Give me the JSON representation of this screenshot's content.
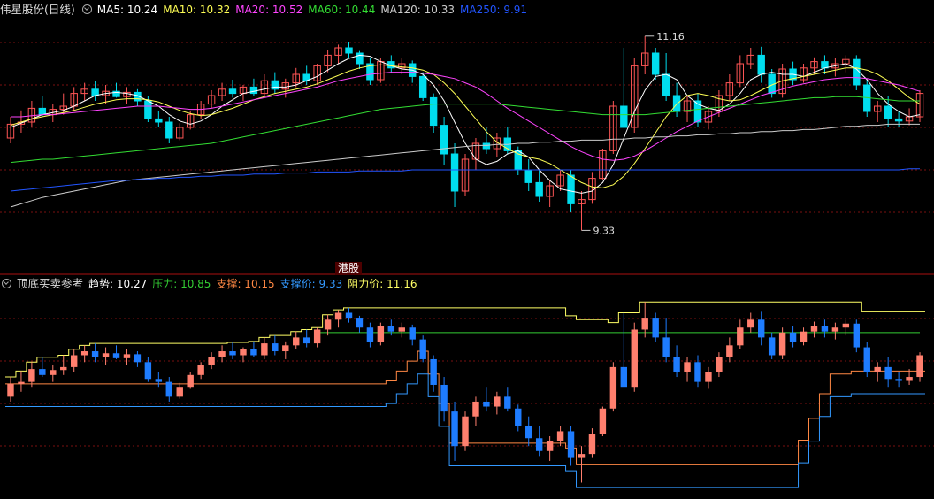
{
  "main_header": {
    "title": "伟星股份(日线)",
    "ma": [
      {
        "label": "MA5: 10.24",
        "color": "#ffffff"
      },
      {
        "label": "MA10: 10.32",
        "color": "#ffff55"
      },
      {
        "label": "MA20: 10.52",
        "color": "#ff44ff"
      },
      {
        "label": "MA60: 10.44",
        "color": "#33dd33"
      },
      {
        "label": "MA120: 10.33",
        "color": "#cccccc"
      },
      {
        "label": "MA250: 9.91",
        "color": "#2255ff"
      }
    ]
  },
  "hk_button": "港股",
  "sub_header": {
    "title": "顶底买卖参考",
    "items": [
      {
        "label": "趋势: 10.27",
        "color": "#ffffff"
      },
      {
        "label": "压力: 10.85",
        "color": "#33cc33"
      },
      {
        "label": "支撑: 10.15",
        "color": "#ff8844"
      },
      {
        "label": "支撑价: 9.33",
        "color": "#3399ff"
      },
      {
        "label": "阻力价: 11.16",
        "color": "#ffff66"
      }
    ]
  },
  "colors": {
    "up": "#ff5555",
    "down": "#00ddee",
    "sub_up": "#ff7f6e",
    "sub_down": "#1e7cff",
    "grid": "#7a1010"
  },
  "chart_data": {
    "type": "candlestick",
    "main": {
      "price_range": [
        9.0,
        11.35
      ],
      "annotations": [
        {
          "label": "11.16",
          "index": 60,
          "value": 11.16
        },
        {
          "label": "9.33",
          "index": 54,
          "value": 9.33
        }
      ],
      "ohlc": [
        [
          10.2,
          10.4,
          10.15,
          10.33
        ],
        [
          10.33,
          10.46,
          10.25,
          10.35
        ],
        [
          10.35,
          10.55,
          10.3,
          10.48
        ],
        [
          10.48,
          10.6,
          10.4,
          10.42
        ],
        [
          10.42,
          10.52,
          10.35,
          10.47
        ],
        [
          10.47,
          10.62,
          10.42,
          10.5
        ],
        [
          10.5,
          10.68,
          10.45,
          10.62
        ],
        [
          10.62,
          10.72,
          10.55,
          10.66
        ],
        [
          10.66,
          10.74,
          10.55,
          10.6
        ],
        [
          10.6,
          10.7,
          10.52,
          10.64
        ],
        [
          10.64,
          10.72,
          10.58,
          10.59
        ],
        [
          10.59,
          10.68,
          10.52,
          10.63
        ],
        [
          10.63,
          10.66,
          10.5,
          10.55
        ],
        [
          10.55,
          10.6,
          10.35,
          10.38
        ],
        [
          10.38,
          10.45,
          10.3,
          10.35
        ],
        [
          10.35,
          10.4,
          10.15,
          10.2
        ],
        [
          10.2,
          10.34,
          10.18,
          10.3
        ],
        [
          10.3,
          10.45,
          10.28,
          10.42
        ],
        [
          10.42,
          10.55,
          10.38,
          10.52
        ],
        [
          10.52,
          10.65,
          10.48,
          10.6
        ],
        [
          10.6,
          10.72,
          10.55,
          10.66
        ],
        [
          10.66,
          10.75,
          10.58,
          10.62
        ],
        [
          10.62,
          10.7,
          10.55,
          10.68
        ],
        [
          10.68,
          10.76,
          10.6,
          10.62
        ],
        [
          10.62,
          10.8,
          10.58,
          10.74
        ],
        [
          10.74,
          10.82,
          10.62,
          10.66
        ],
        [
          10.66,
          10.76,
          10.58,
          10.72
        ],
        [
          10.72,
          10.86,
          10.68,
          10.8
        ],
        [
          10.8,
          10.88,
          10.7,
          10.74
        ],
        [
          10.74,
          10.9,
          10.7,
          10.88
        ],
        [
          10.88,
          11.03,
          10.82,
          10.98
        ],
        [
          10.98,
          11.08,
          10.9,
          11.05
        ],
        [
          11.05,
          11.1,
          10.95,
          11.0
        ],
        [
          11.0,
          11.02,
          10.85,
          10.9
        ],
        [
          10.9,
          10.95,
          10.7,
          10.75
        ],
        [
          10.75,
          10.95,
          10.72,
          10.92
        ],
        [
          10.92,
          10.98,
          10.82,
          10.86
        ],
        [
          10.86,
          10.95,
          10.8,
          10.9
        ],
        [
          10.9,
          10.93,
          10.72,
          10.78
        ],
        [
          10.78,
          10.82,
          10.55,
          10.58
        ],
        [
          10.58,
          10.62,
          10.25,
          10.32
        ],
        [
          10.32,
          10.4,
          9.95,
          10.05
        ],
        [
          10.05,
          10.15,
          9.55,
          9.7
        ],
        [
          9.7,
          10.05,
          9.65,
          10.0
        ],
        [
          10.0,
          10.2,
          9.9,
          10.15
        ],
        [
          10.15,
          10.3,
          10.05,
          10.1
        ],
        [
          10.1,
          10.25,
          10.02,
          10.2
        ],
        [
          10.2,
          10.3,
          10.05,
          10.08
        ],
        [
          10.08,
          10.12,
          9.85,
          9.9
        ],
        [
          9.9,
          10.0,
          9.7,
          9.78
        ],
        [
          9.78,
          9.9,
          9.6,
          9.65
        ],
        [
          9.65,
          9.8,
          9.55,
          9.75
        ],
        [
          9.75,
          9.9,
          9.7,
          9.85
        ],
        [
          9.85,
          9.9,
          9.5,
          9.58
        ],
        [
          9.58,
          9.7,
          9.33,
          9.62
        ],
        [
          9.62,
          9.88,
          9.58,
          9.82
        ],
        [
          9.82,
          10.1,
          9.8,
          10.08
        ],
        [
          10.08,
          10.55,
          10.05,
          10.5
        ],
        [
          10.5,
          11.05,
          10.4,
          10.3
        ],
        [
          10.3,
          10.95,
          10.25,
          10.88
        ],
        [
          10.88,
          11.16,
          10.8,
          11.0
        ],
        [
          11.0,
          11.05,
          10.75,
          10.8
        ],
        [
          10.8,
          11.0,
          10.55,
          10.6
        ],
        [
          10.6,
          10.72,
          10.4,
          10.45
        ],
        [
          10.45,
          10.6,
          10.35,
          10.55
        ],
        [
          10.55,
          10.62,
          10.3,
          10.35
        ],
        [
          10.35,
          10.5,
          10.28,
          10.45
        ],
        [
          10.45,
          10.65,
          10.4,
          10.6
        ],
        [
          10.6,
          10.8,
          10.55,
          10.72
        ],
        [
          10.72,
          10.98,
          10.68,
          10.9
        ],
        [
          10.9,
          11.05,
          10.85,
          10.98
        ],
        [
          10.98,
          11.06,
          10.72,
          10.8
        ],
        [
          10.8,
          10.85,
          10.58,
          10.62
        ],
        [
          10.62,
          10.9,
          10.58,
          10.85
        ],
        [
          10.85,
          10.92,
          10.7,
          10.75
        ],
        [
          10.75,
          10.9,
          10.72,
          10.86
        ],
        [
          10.86,
          10.96,
          10.8,
          10.92
        ],
        [
          10.92,
          10.98,
          10.8,
          10.86
        ],
        [
          10.86,
          10.95,
          10.78,
          10.9
        ],
        [
          10.9,
          10.98,
          10.82,
          10.94
        ],
        [
          10.94,
          10.98,
          10.65,
          10.7
        ],
        [
          10.7,
          10.75,
          10.4,
          10.45
        ],
        [
          10.45,
          10.55,
          10.35,
          10.5
        ],
        [
          10.5,
          10.6,
          10.3,
          10.38
        ],
        [
          10.38,
          10.45,
          10.3,
          10.36
        ],
        [
          10.36,
          10.48,
          10.32,
          10.4
        ],
        [
          10.4,
          10.65,
          10.35,
          10.62
        ]
      ],
      "ma": {
        "MA5": [
          10.3,
          10.34,
          10.38,
          10.42,
          10.44,
          10.46,
          10.5,
          10.55,
          10.6,
          10.62,
          10.63,
          10.62,
          10.6,
          10.55,
          10.5,
          10.42,
          10.36,
          10.33,
          10.36,
          10.42,
          10.5,
          10.56,
          10.62,
          10.64,
          10.66,
          10.68,
          10.68,
          10.7,
          10.74,
          10.78,
          10.84,
          10.9,
          10.95,
          10.98,
          10.97,
          10.92,
          10.88,
          10.85,
          10.84,
          10.8,
          10.7,
          10.55,
          10.35,
          10.15,
          10.0,
          9.95,
          9.98,
          10.05,
          10.08,
          10.02,
          9.9,
          9.8,
          9.72,
          9.7,
          9.68,
          9.7,
          9.78,
          9.95,
          10.2,
          10.45,
          10.65,
          10.78,
          10.8,
          10.75,
          10.6,
          10.52,
          10.48,
          10.46,
          10.52,
          10.62,
          10.75,
          10.8,
          10.82,
          10.8,
          10.8,
          10.78,
          10.82,
          10.86,
          10.88,
          10.9,
          10.85,
          10.75,
          10.62,
          10.52,
          10.45,
          10.4,
          10.42
        ],
        "MA10": [
          10.32,
          10.35,
          10.38,
          10.4,
          10.42,
          10.44,
          10.46,
          10.49,
          10.52,
          10.54,
          10.56,
          10.57,
          10.57,
          10.56,
          10.54,
          10.5,
          10.46,
          10.43,
          10.41,
          10.42,
          10.45,
          10.48,
          10.52,
          10.56,
          10.59,
          10.62,
          10.64,
          10.66,
          10.68,
          10.71,
          10.75,
          10.79,
          10.83,
          10.86,
          10.88,
          10.89,
          10.88,
          10.87,
          10.86,
          10.84,
          10.8,
          10.72,
          10.62,
          10.5,
          10.38,
          10.26,
          10.16,
          10.1,
          10.05,
          10.02,
          10.0,
          9.96,
          9.9,
          9.84,
          9.78,
          9.74,
          9.73,
          9.76,
          9.84,
          9.96,
          10.1,
          10.25,
          10.4,
          10.52,
          10.6,
          10.62,
          10.6,
          10.57,
          10.55,
          10.56,
          10.6,
          10.65,
          10.7,
          10.74,
          10.76,
          10.78,
          10.8,
          10.82,
          10.84,
          10.86,
          10.86,
          10.84,
          10.8,
          10.74,
          10.66,
          10.58,
          10.52
        ],
        "MA20": [
          10.4,
          10.4,
          10.41,
          10.42,
          10.42,
          10.43,
          10.44,
          10.45,
          10.46,
          10.47,
          10.48,
          10.49,
          10.5,
          10.5,
          10.5,
          10.49,
          10.48,
          10.47,
          10.47,
          10.48,
          10.5,
          10.52,
          10.54,
          10.56,
          10.58,
          10.6,
          10.62,
          10.64,
          10.66,
          10.68,
          10.71,
          10.74,
          10.76,
          10.78,
          10.8,
          10.81,
          10.82,
          10.82,
          10.82,
          10.81,
          10.8,
          10.78,
          10.76,
          10.72,
          10.68,
          10.62,
          10.55,
          10.48,
          10.42,
          10.36,
          10.3,
          10.24,
          10.18,
          10.12,
          10.07,
          10.03,
          10.0,
          9.99,
          10.0,
          10.03,
          10.08,
          10.14,
          10.2,
          10.26,
          10.31,
          10.36,
          10.4,
          10.44,
          10.48,
          10.52,
          10.56,
          10.6,
          10.63,
          10.66,
          10.69,
          10.71,
          10.73,
          10.75,
          10.76,
          10.77,
          10.77,
          10.76,
          10.74,
          10.72,
          10.7,
          10.67,
          10.64
        ],
        "MA60": [
          9.97,
          9.98,
          9.99,
          10.0,
          10.0,
          10.01,
          10.02,
          10.03,
          10.04,
          10.05,
          10.06,
          10.07,
          10.08,
          10.09,
          10.1,
          10.11,
          10.12,
          10.13,
          10.14,
          10.15,
          10.17,
          10.19,
          10.21,
          10.23,
          10.25,
          10.27,
          10.29,
          10.31,
          10.33,
          10.35,
          10.37,
          10.39,
          10.41,
          10.43,
          10.45,
          10.47,
          10.48,
          10.49,
          10.5,
          10.51,
          10.52,
          10.52,
          10.52,
          10.52,
          10.52,
          10.52,
          10.52,
          10.51,
          10.5,
          10.49,
          10.48,
          10.47,
          10.46,
          10.45,
          10.44,
          10.43,
          10.42,
          10.42,
          10.42,
          10.42,
          10.42,
          10.43,
          10.44,
          10.45,
          10.46,
          10.47,
          10.48,
          10.49,
          10.5,
          10.51,
          10.52,
          10.53,
          10.54,
          10.55,
          10.56,
          10.57,
          10.58,
          10.58,
          10.59,
          10.59,
          10.59,
          10.58,
          10.57,
          10.56,
          10.55,
          10.55,
          10.55
        ],
        "MA120": [
          9.55,
          9.58,
          9.61,
          9.64,
          9.66,
          9.68,
          9.7,
          9.72,
          9.74,
          9.76,
          9.78,
          9.8,
          9.81,
          9.82,
          9.83,
          9.84,
          9.85,
          9.86,
          9.87,
          9.88,
          9.89,
          9.9,
          9.91,
          9.92,
          9.93,
          9.94,
          9.95,
          9.96,
          9.97,
          9.98,
          9.99,
          10.0,
          10.01,
          10.02,
          10.03,
          10.04,
          10.05,
          10.06,
          10.07,
          10.08,
          10.09,
          10.1,
          10.11,
          10.12,
          10.13,
          10.13,
          10.14,
          10.14,
          10.15,
          10.15,
          10.16,
          10.16,
          10.17,
          10.17,
          10.18,
          10.18,
          10.18,
          10.19,
          10.19,
          10.2,
          10.2,
          10.21,
          10.21,
          10.22,
          10.22,
          10.23,
          10.23,
          10.24,
          10.24,
          10.25,
          10.25,
          10.26,
          10.26,
          10.27,
          10.27,
          10.28,
          10.28,
          10.29,
          10.3,
          10.31,
          10.31,
          10.32,
          10.32,
          10.33,
          10.33,
          10.33,
          10.33
        ],
        "MA250": [
          9.7,
          9.71,
          9.72,
          9.73,
          9.74,
          9.75,
          9.76,
          9.77,
          9.78,
          9.79,
          9.8,
          9.8,
          9.81,
          9.81,
          9.82,
          9.82,
          9.83,
          9.83,
          9.84,
          9.84,
          9.85,
          9.85,
          9.85,
          9.86,
          9.86,
          9.86,
          9.87,
          9.87,
          9.87,
          9.88,
          9.88,
          9.88,
          9.88,
          9.89,
          9.89,
          9.89,
          9.89,
          9.89,
          9.9,
          9.9,
          9.9,
          9.9,
          9.9,
          9.9,
          9.9,
          9.9,
          9.9,
          9.9,
          9.9,
          9.9,
          9.9,
          9.9,
          9.9,
          9.9,
          9.9,
          9.9,
          9.9,
          9.9,
          9.9,
          9.9,
          9.9,
          9.9,
          9.9,
          9.9,
          9.9,
          9.9,
          9.9,
          9.9,
          9.9,
          9.9,
          9.9,
          9.9,
          9.9,
          9.9,
          9.9,
          9.9,
          9.9,
          9.9,
          9.9,
          9.9,
          9.9,
          9.9,
          9.9,
          9.9,
          9.9,
          9.91,
          9.91
        ]
      }
    },
    "sub": {
      "value_range": [
        9.2,
        11.35
      ],
      "resistance_price": 11.16,
      "support_price": 9.33,
      "resistance_line": 10.85,
      "support_line": 10.15,
      "trend": 10.27
    }
  }
}
